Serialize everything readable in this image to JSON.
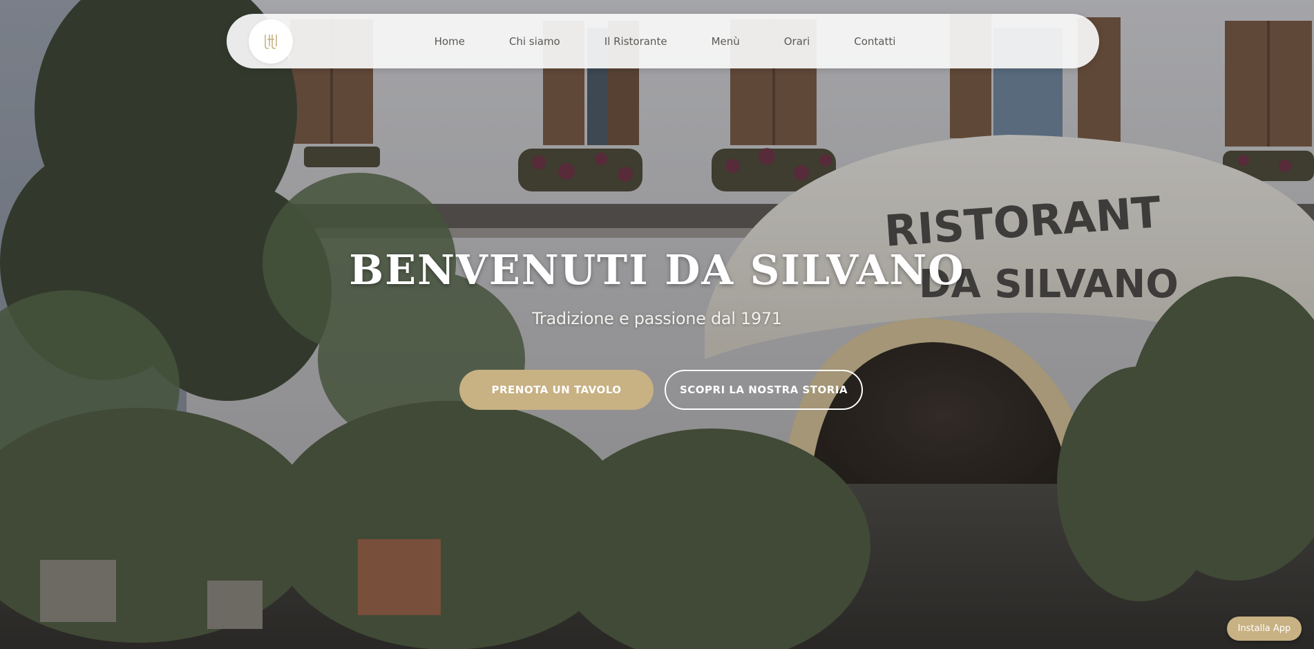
{
  "nav": {
    "logo_name": "restaurant-logo",
    "links": [
      {
        "label": "Home"
      },
      {
        "label": "Chi siamo"
      },
      {
        "label": "Il Ristorante"
      },
      {
        "label": "Menù"
      },
      {
        "label": "Orari"
      },
      {
        "label": "Contatti"
      }
    ]
  },
  "hero": {
    "title": "BENVENUTI DA SILVANO",
    "subtitle": "Tradizione e passione dal 1971",
    "sign_line1": "RISTORANTE",
    "sign_line2": "DA SILVANO",
    "primary_cta": "PRENOTA UN TAVOLO",
    "secondary_cta": "SCOPRI LA NOSTRA STORIA"
  },
  "install_button": "Installa App",
  "colors": {
    "accent": "#c8b183",
    "navbar_bg": "#f7f7f7",
    "nav_text": "#5b5954",
    "title_text": "#ffffff"
  }
}
